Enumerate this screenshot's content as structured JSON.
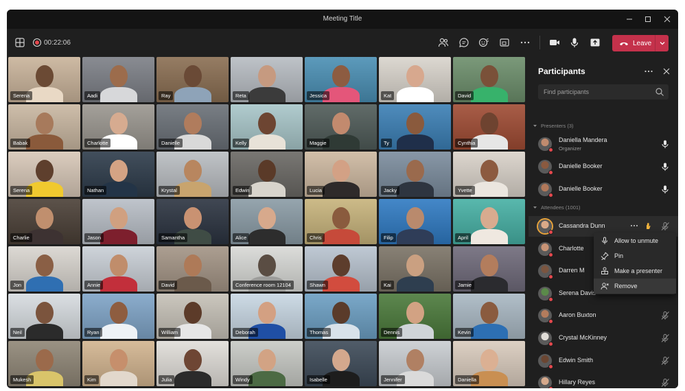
{
  "window": {
    "title": "Meeting Title"
  },
  "toolbar": {
    "timer": "00:22:06",
    "leave_label": "Leave",
    "icons": [
      "grid-layout-icon",
      "record-icon",
      "people-icon",
      "chat-icon",
      "reactions-icon",
      "share-tray-icon",
      "more-icon",
      "camera-icon",
      "mic-icon",
      "share-icon",
      "phone-icon",
      "chevron-down-icon"
    ]
  },
  "grid": {
    "tiles": [
      {
        "name": "Serena",
        "bg": "#c9b39a",
        "skin": "#6b4a34",
        "shirt": "#e9d9c5"
      },
      {
        "name": "Aadi",
        "bg": "#7c7f86",
        "skin": "#9c6c4c",
        "shirt": "#d7d8da"
      },
      {
        "name": "Ray",
        "bg": "#8a6e52",
        "skin": "#6a4a36",
        "shirt": "#8ea3b8"
      },
      {
        "name": "Reta",
        "bg": "#b7bcc2",
        "skin": "#c69a80",
        "shirt": "#3b3b3b"
      },
      {
        "name": "Jessica",
        "bg": "#4a8fb4",
        "skin": "#8d5c41",
        "shirt": "#e4567a"
      },
      {
        "name": "Kat",
        "bg": "#d9d4cc",
        "skin": "#d7a88e",
        "shirt": "#ffffff"
      },
      {
        "name": "David",
        "bg": "#6c8e6b",
        "skin": "#7a5139",
        "shirt": "#37b26b"
      },
      {
        "name": "Babak",
        "bg": "#c9b7a1",
        "skin": "#a77a5c",
        "shirt": "#8a5a3b"
      },
      {
        "name": "Charlotte",
        "bg": "#9a968f",
        "skin": "#d6ab90",
        "shirt": "#ffffff"
      },
      {
        "name": "Danielle",
        "bg": "#6a7077",
        "skin": "#b07c5d",
        "shirt": "#d9d9d9"
      },
      {
        "name": "Kelly",
        "bg": "#a8c6c9",
        "skin": "#6d4532",
        "shirt": "#e8e2d8"
      },
      {
        "name": "Maggie",
        "bg": "#4f5b58",
        "skin": "#c28a6e",
        "shirt": "#2f3a35"
      },
      {
        "name": "Ty",
        "bg": "#3b7fb5",
        "skin": "#8a5a3d",
        "shirt": "#1f2f4a"
      },
      {
        "name": "Cynthia",
        "bg": "#9f4b33",
        "skin": "#6e4330",
        "shirt": "#e6e6e6"
      },
      {
        "name": "Serena",
        "bg": "#d7c7b7",
        "skin": "#5e3f2d",
        "shirt": "#f0c92f"
      },
      {
        "name": "Nathan",
        "bg": "#2d3b4a",
        "skin": "#d4a384",
        "shirt": "#233447"
      },
      {
        "name": "Krystal",
        "bg": "#b9bdc1",
        "skin": "#b8865f",
        "shirt": "#c8a46e"
      },
      {
        "name": "Edwin",
        "bg": "#6a6864",
        "skin": "#5a3a28",
        "shirt": "#d8d4cc"
      },
      {
        "name": "Lucia",
        "bg": "#cdb8a0",
        "skin": "#d3a185",
        "shirt": "#2e2a2a"
      },
      {
        "name": "Jacky",
        "bg": "#7b8c9d",
        "skin": "#9a6a4d",
        "shirt": "#2e3540"
      },
      {
        "name": "Yvette",
        "bg": "#d9d2c9",
        "skin": "#8c5a3f",
        "shirt": "#ebe6df"
      },
      {
        "name": "Charlie",
        "bg": "#4a3f36",
        "skin": "#c08f6e",
        "shirt": "#3d3232"
      },
      {
        "name": "Jason",
        "bg": "#b8bec6",
        "skin": "#d0a080",
        "shirt": "#7d1f2d"
      },
      {
        "name": "Samantha",
        "bg": "#2b3340",
        "skin": "#c99272",
        "shirt": "#3f4c45"
      },
      {
        "name": "Alice",
        "bg": "#8a9ba5",
        "skin": "#d7a98c",
        "shirt": "#2d2d2d"
      },
      {
        "name": "Chris",
        "bg": "#c7b37b",
        "skin": "#8a5b3e",
        "shirt": "#c64a3a"
      },
      {
        "name": "Filip",
        "bg": "#2f7ac2",
        "skin": "#b98a6d",
        "shirt": "#2f3d58"
      },
      {
        "name": "April",
        "bg": "#46b0a4",
        "skin": "#d8ab8f",
        "shirt": "#efe8e0"
      },
      {
        "name": "Jon",
        "bg": "#d9d5cf",
        "skin": "#8a5f45",
        "shirt": "#2f6fb2"
      },
      {
        "name": "Annie",
        "bg": "#c9cfd6",
        "skin": "#c08d6b",
        "shirt": "#c22f3b"
      },
      {
        "name": "David",
        "bg": "#a39485",
        "skin": "#ae7a58",
        "shirt": "#6b5a4b"
      },
      {
        "name": "Conference room 12104",
        "bg": "#d8d9d6",
        "skin": "#5a4d43",
        "shirt": "#9c9c9a"
      },
      {
        "name": "Shawn",
        "bg": "#b8c3cf",
        "skin": "#5d3d2c",
        "shirt": "#d24c3e"
      },
      {
        "name": "Kai",
        "bg": "#7b7366",
        "skin": "#caa081",
        "shirt": "#2e3e4f"
      },
      {
        "name": "Jamie",
        "bg": "#6f6a7a",
        "skin": "#b37d5d",
        "shirt": "#2b2b2f"
      },
      {
        "name": "Neil",
        "bg": "#d7dce0",
        "skin": "#7b543d",
        "shirt": "#2b2b2b"
      },
      {
        "name": "Ryan",
        "bg": "#7fa4c7",
        "skin": "#8e5d40",
        "shirt": "#eef2f6"
      },
      {
        "name": "William",
        "bg": "#c6c1b7",
        "skin": "#5c3b29",
        "shirt": "#e6e6e6"
      },
      {
        "name": "Deborah",
        "bg": "#c8d7e3",
        "skin": "#d3a082",
        "shirt": "#1f4fa5"
      },
      {
        "name": "Thomas",
        "bg": "#6c9fc3",
        "skin": "#5a3b2a",
        "shirt": "#d8e2ea"
      },
      {
        "name": "Dennis",
        "bg": "#4b7a3b",
        "skin": "#d2a283",
        "shirt": "#cfd4d8"
      },
      {
        "name": "Kevin",
        "bg": "#a9b8c3",
        "skin": "#8a5b3f",
        "shirt": "#2d6fb3"
      },
      {
        "name": "Mukesh",
        "bg": "#8f8676",
        "skin": "#9b6a4b",
        "shirt": "#d9c46a"
      },
      {
        "name": "Kim",
        "bg": "#d2b48f",
        "skin": "#c68f6c",
        "shirt": "#e2d8cc"
      },
      {
        "name": "Julia",
        "bg": "#e0ddd8",
        "skin": "#6e4634",
        "shirt": "#2b2b2b"
      },
      {
        "name": "Windy",
        "bg": "#c7c9c4",
        "skin": "#d2a384",
        "shirt": "#4c6a44"
      },
      {
        "name": "Isabelle",
        "bg": "#3d4a58",
        "skin": "#d4a88d",
        "shirt": "#1d1d1d"
      },
      {
        "name": "Jennifer",
        "bg": "#c9cdd1",
        "skin": "#b08063",
        "shirt": "#dadada"
      },
      {
        "name": "Daniella",
        "bg": "#d9cbbd",
        "skin": "#dbb093",
        "shirt": "#c98f52"
      }
    ]
  },
  "panel": {
    "title": "Participants",
    "search_placeholder": "Find participants",
    "presenters_label": "Presenters (3)",
    "attendees_label": "Attendees (1001)",
    "presenters": [
      {
        "name": "Daniella Mandera",
        "role": "Organizer",
        "color": "#c08b6e"
      },
      {
        "name": "Danielle Booker",
        "role": "",
        "color": "#8a5a40"
      },
      {
        "name": "Danielle Booker",
        "role": "",
        "color": "#b0785a"
      }
    ],
    "attendees": [
      {
        "name": "Cassandra Dunn",
        "color": "#d9a988",
        "muted": true
      },
      {
        "name": "Charlotte",
        "color": "#c89476",
        "muted": true
      },
      {
        "name": "Darren M",
        "color": "#7a5540",
        "muted": true
      },
      {
        "name": "Serena Davis",
        "color": "#5b8a4a",
        "muted": true
      },
      {
        "name": "Aaron Buxton",
        "color": "#b37c5d",
        "muted": true
      },
      {
        "name": "Crystal McKinney",
        "color": "#e0ddd8",
        "muted": true
      },
      {
        "name": "Edwin Smith",
        "color": "#6a4632",
        "muted": true
      },
      {
        "name": "Hillary Reyes",
        "color": "#d6a98c",
        "muted": true
      }
    ]
  },
  "context_menu": {
    "items": [
      {
        "label": "Allow to unmute",
        "icon": "mic-icon"
      },
      {
        "label": "Pin",
        "icon": "pin-icon"
      },
      {
        "label": "Make a presenter",
        "icon": "presenter-icon"
      },
      {
        "label": "Remove",
        "icon": "remove-person-icon"
      }
    ]
  }
}
